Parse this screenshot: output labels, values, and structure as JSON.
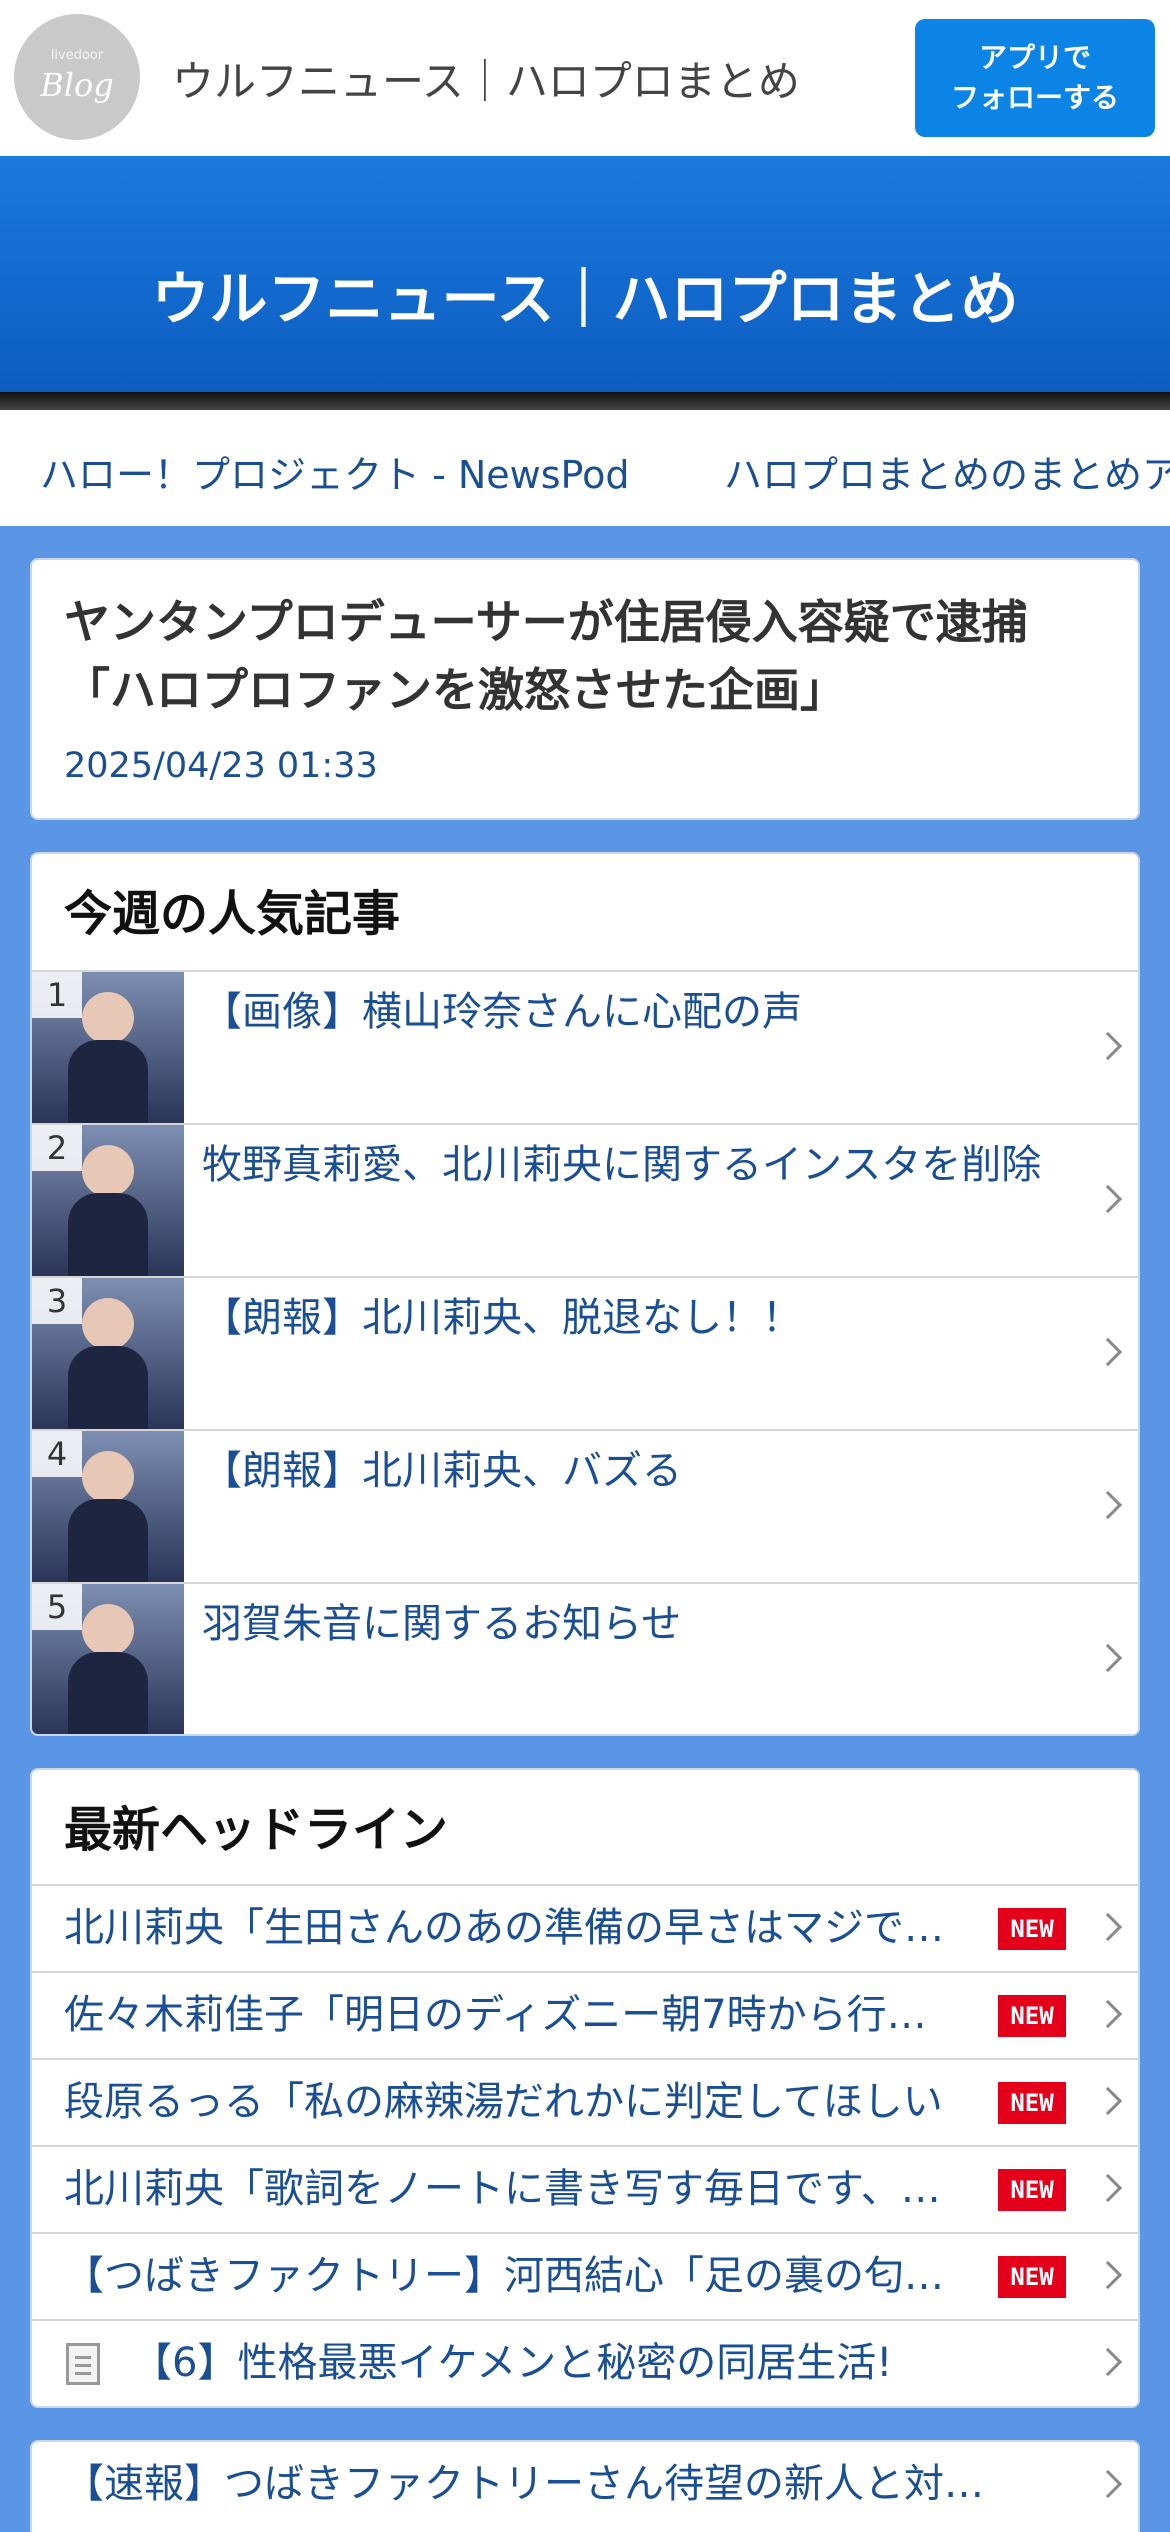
{
  "topbar": {
    "logo_small": "livedoor",
    "logo_big": "Blog",
    "title": "ウルフニュース｜ハロプロまとめ",
    "follow_line1": "アプリで",
    "follow_line2": "フォローする"
  },
  "banner": {
    "title": "ウルフニュース｜ハロプロまとめ"
  },
  "linkstrip": {
    "links": [
      "ハロー！プロジェクト - NewsPod",
      "ハロプロまとめのまとめア"
    ]
  },
  "article": {
    "title": "ヤンタンプロデューサーが住居侵入容疑で逮捕「ハロプロファンを激怒させた企画」",
    "date": "2025/04/23 01:33"
  },
  "ranking": {
    "title": "今週の人気記事",
    "items": [
      {
        "num": "1",
        "text": "【画像】横山玲奈さんに心配の声"
      },
      {
        "num": "2",
        "text": "牧野真莉愛、北川莉央に関するインスタを削除"
      },
      {
        "num": "3",
        "text": "【朗報】北川莉央、脱退なし！！"
      },
      {
        "num": "4",
        "text": "【朗報】北川莉央、バズる"
      },
      {
        "num": "5",
        "text": "羽賀朱音に関するお知らせ"
      }
    ]
  },
  "headlines": {
    "title": "最新ヘッドライン",
    "badge": "NEW",
    "items": [
      {
        "text": "北川莉央「生田さんのあの準備の早さはマジで…"
      },
      {
        "text": "佐々木莉佳子「明日のディズニー朝7時から行…"
      },
      {
        "text": "段原るっる「私の麻辣湯だれかに判定してほしい"
      },
      {
        "text": "北川莉央「歌詞をノートに書き写す毎日です、…"
      },
      {
        "text": "【つばきファクトリー】河西結心「足の裏の匂…"
      },
      {
        "text": "【6】性格最悪イケメンと秘密の同居生活!"
      }
    ]
  },
  "bottom": {
    "text": "【速報】つばきファクトリーさん待望の新人と対…"
  },
  "colors": {
    "accent": "#0b84e6",
    "banner": "#1a79de",
    "background": "#5b95e6",
    "link": "#1b4f93",
    "new_badge": "#e4001b"
  }
}
